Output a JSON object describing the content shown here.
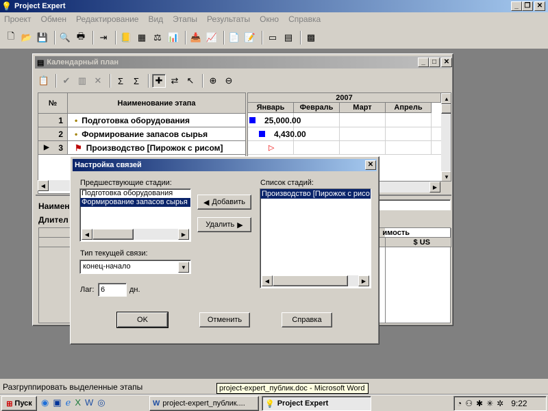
{
  "app": {
    "title": "Project Expert",
    "menu": [
      "Проект",
      "Обмен",
      "Редактирование",
      "Вид",
      "Этапы",
      "Результаты",
      "Окно",
      "Справка"
    ],
    "caption_buttons": [
      "_",
      "❐",
      "✕"
    ]
  },
  "toolbar_icons": [
    "new-doc-icon",
    "open-folder-icon",
    "save-icon",
    "print-preview-icon",
    "print-icon",
    "exit-icon",
    "book-icon",
    "cashflow-table-icon",
    "scales-icon",
    "chart-icon",
    "import-icon",
    "line-chart-icon",
    "report-icon",
    "report-edit-icon",
    "form-icon",
    "form2-icon",
    "analysis-icon"
  ],
  "calendar_window": {
    "title": "Календарный план",
    "columns": {
      "num": "№",
      "name": "Наименование этапа"
    },
    "rows": [
      {
        "num": "1",
        "name": "Подготовка оборудования",
        "marker": "•"
      },
      {
        "num": "2",
        "name": "Формирование запасов сырья",
        "marker": "•"
      },
      {
        "num": "3",
        "name": "Производство [Пирожок с рисом]",
        "marker": "⚑",
        "current": "▶"
      }
    ],
    "gantt": {
      "year": "2007",
      "months": [
        "Январь",
        "Февраль",
        "Март",
        "Апрель"
      ],
      "values": [
        "25,000.00",
        "4,430.00",
        ""
      ],
      "bar_color": "#0000ff"
    },
    "lower_panel": {
      "name_label": "Наимен",
      "duration_label": "Длител",
      "cost_header": "имость",
      "currency_header": "$ US"
    }
  },
  "dialog": {
    "title": "Настройка связей",
    "predecessors_label": "Предшествующие стадии:",
    "predecessors": [
      "Подготовка оборудования",
      "Формирование запасов сырья"
    ],
    "add_button": "Добавить",
    "remove_button": "Удалить",
    "stages_label": "Список стадий:",
    "stages": [
      "Производство [Пирожок с рисо"
    ],
    "link_type_label": "Тип текущей связи:",
    "link_type_value": "конец-начало",
    "lag_label": "Лаг:",
    "lag_value": "6",
    "lag_unit": "дн.",
    "ok": "OK",
    "cancel": "Отменить",
    "help": "Справка"
  },
  "status": {
    "text": "Разгруппировать выделенные этапы",
    "tooltip": "project-expert_публик.doc - Microsoft Word"
  },
  "taskbar": {
    "start": "Пуск",
    "tasks": [
      "project-expert_публик....",
      "Project Expert"
    ],
    "clock": "9:22"
  }
}
